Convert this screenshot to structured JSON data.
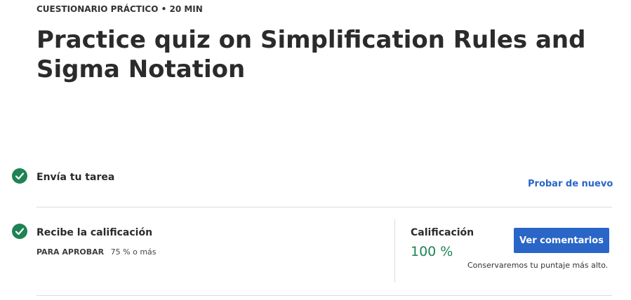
{
  "header": {
    "eyebrow": "CUESTIONARIO PRÁCTICO • 20 MIN",
    "title": "Practice quiz on Simplification Rules and Sigma Notation"
  },
  "steps": [
    {
      "title": "Envía tu tarea",
      "status_icon": "check-circle-icon",
      "action_label": "Probar de nuevo"
    },
    {
      "title": "Recibe la calificación",
      "status_icon": "check-circle-icon",
      "pass_label": "PARA APROBAR",
      "pass_value": "75 % o más"
    }
  ],
  "grade": {
    "label": "Calificación",
    "value": "100 %",
    "button_label": "Ver comentarios",
    "note": "Conservaremos tu puntaje más alto."
  },
  "colors": {
    "accent": "#2a65c8",
    "success": "#1f8354"
  }
}
